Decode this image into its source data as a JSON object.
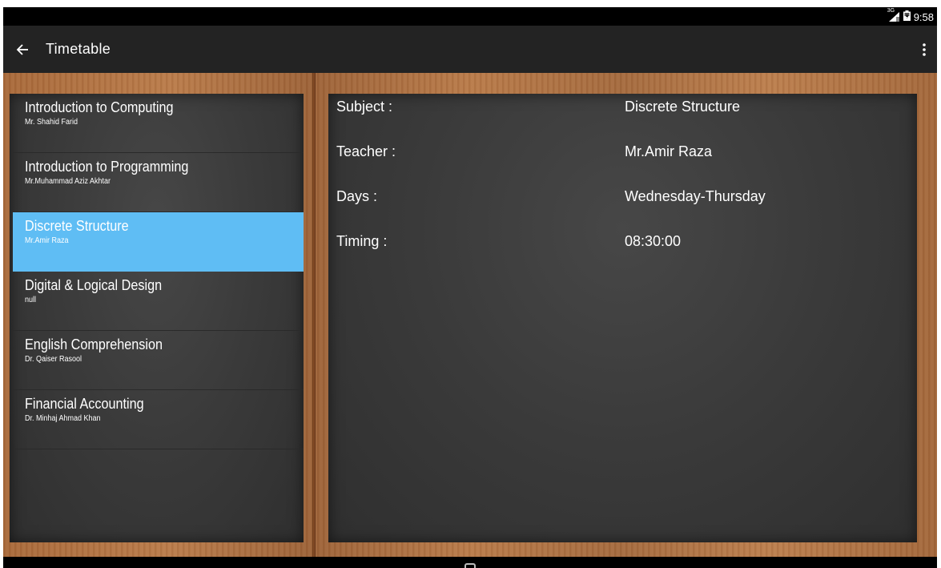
{
  "status_bar": {
    "network_type": "3G",
    "time": "9:58"
  },
  "action_bar": {
    "title": "Timetable",
    "back_icon": "arrow-left-icon",
    "overflow_icon": "more-vert-icon"
  },
  "courses": [
    {
      "name": "Introduction to Computing",
      "teacher": "Mr. Shahid Farid",
      "selected": false
    },
    {
      "name": "Introduction to Programming",
      "teacher": "Mr.Muhammad Aziz Akhtar",
      "selected": false
    },
    {
      "name": "Discrete Structure",
      "teacher": "Mr.Amir Raza",
      "selected": true
    },
    {
      "name": "Digital & Logical Design",
      "teacher": "null",
      "selected": false
    },
    {
      "name": "English Comprehension",
      "teacher": "Dr. Qaiser Rasool",
      "selected": false
    },
    {
      "name": "Financial Accounting",
      "teacher": "Dr. Minhaj Ahmad Khan",
      "selected": false
    }
  ],
  "details": {
    "subject_label": "Subject :",
    "subject_value": "Discrete Structure",
    "teacher_label": "Teacher :",
    "teacher_value": "Mr.Amir Raza",
    "days_label": "Days :",
    "days_value": "Wednesday-Thursday",
    "timing_label": "Timing :",
    "timing_value": "08:30:00"
  },
  "colors": {
    "action_bar": "#232323",
    "selected_item": "#5fbdf4",
    "chalkboard": "#3a3a3a",
    "wood": "#a8693a"
  }
}
